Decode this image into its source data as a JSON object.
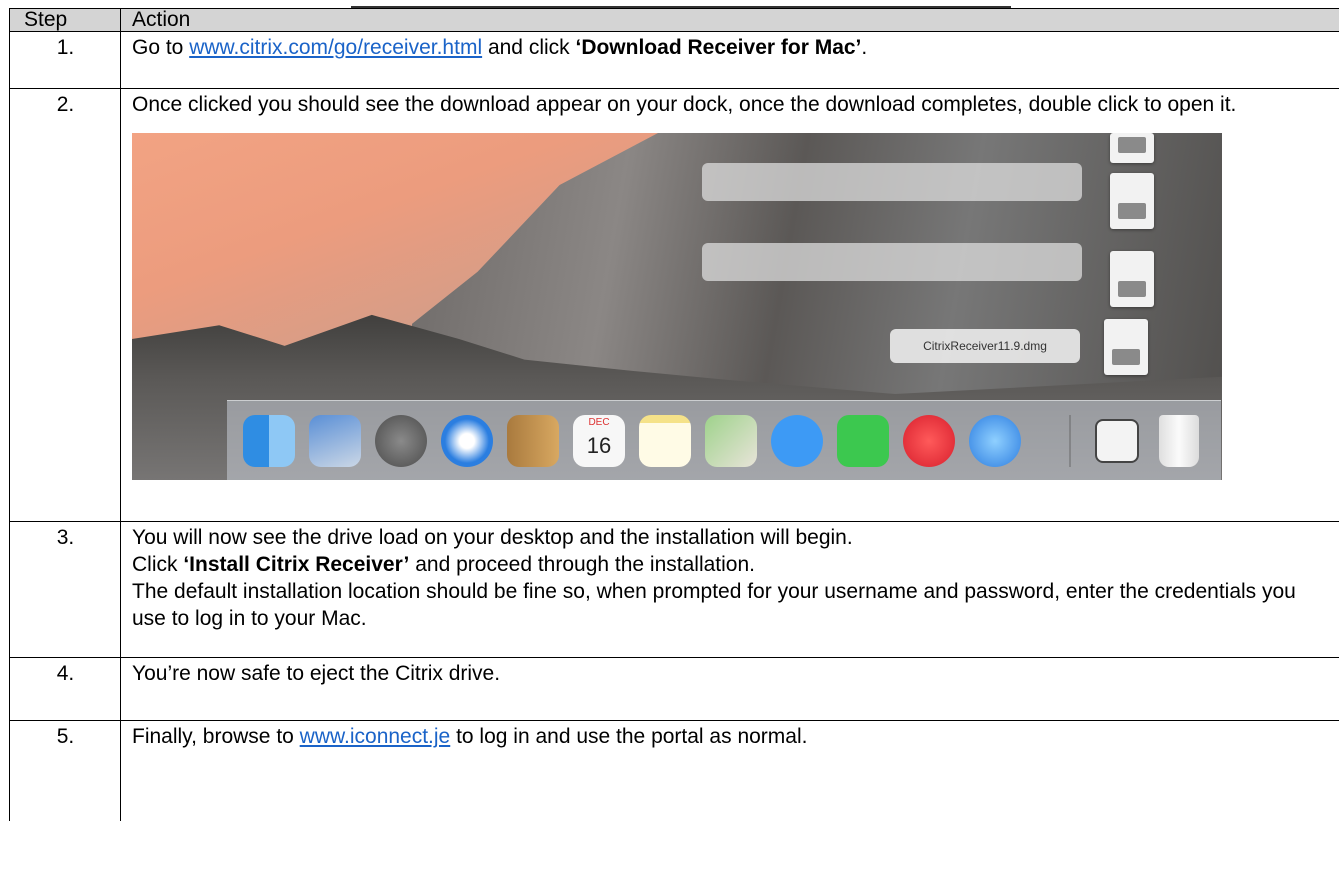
{
  "table": {
    "headers": {
      "step": "Step",
      "action": "Action"
    },
    "rows": [
      {
        "step": "1.",
        "parts": {
          "t1": "Go to ",
          "link": "www.citrix.com/go/receiver.html",
          "t2": " and click ",
          "b1": "‘Download Receiver for Mac’",
          "t3": "."
        }
      },
      {
        "step": "2.",
        "text": "Once clicked you should see the download appear on your dock, once the download completes, double click to open it."
      },
      {
        "step": "3.",
        "line1": "You will now see the drive load on your desktop and the installation will begin.",
        "line2_pre": "Click ",
        "line2_bold": "‘Install Citrix Receiver’",
        "line2_post": " and proceed through the installation.",
        "line3": "The default installation location should be fine so, when prompted for your username and password, enter the credentials you use to log in to your Mac."
      },
      {
        "step": "4.",
        "text": "You’re now safe to eject the Citrix drive."
      },
      {
        "step": "5.",
        "parts": {
          "t1": "Finally, browse to ",
          "link": "www.iconnect.je",
          "t2": " to log in and use the portal as normal."
        }
      }
    ]
  },
  "screenshot": {
    "tooltip": "CitrixReceiver11.9.dmg",
    "calendar_month": "DEC",
    "calendar_day": "16",
    "dock_icons": [
      "finder-icon",
      "preview-icon",
      "launchpad-icon",
      "safari-icon",
      "contacts-icon",
      "calendar-icon",
      "notes-icon",
      "maps-icon",
      "messages-icon",
      "facetime-icon",
      "itunes-icon",
      "app-store-icon",
      "downloads-stack-icon",
      "trash-icon"
    ]
  }
}
